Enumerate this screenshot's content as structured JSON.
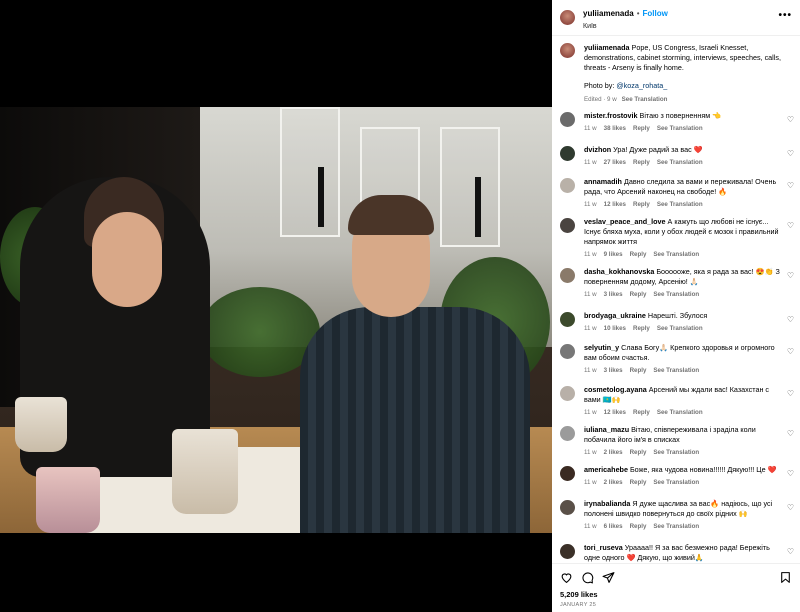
{
  "post": {
    "username": "yuliiamenada",
    "follow_label": "Follow",
    "location": "Київ",
    "more_label": "•••",
    "caption_text": " Pope, US Congress, Israeli Knesset, demonstrations, cabinet storming, interviews, speeches, calls, threats - Arseny is finally home.",
    "photo_by_label": "Photo by: ",
    "photo_by_handle": "@koza_rohata_",
    "edited": "Edited · 9 w",
    "see_translation": "See Translation",
    "likes": "5,209 likes",
    "date": "JANUARY 25"
  },
  "comments": [
    {
      "user": "mister.frostovik",
      "text": "Вітаю з поверненням 👈",
      "time": "11 w",
      "likes": "38 likes",
      "reply": "Reply",
      "translate": "See Translation",
      "avatar_color": "#6b6b6b"
    },
    {
      "user": "dvizhon",
      "text": "Ура! Дуже радий за вас ❤️",
      "time": "11 w",
      "likes": "27 likes",
      "reply": "Reply",
      "translate": "See Translation",
      "avatar_color": "#2f3a2f"
    },
    {
      "user": "annamadih",
      "text": "Давно следила за вами и переживала! Очень рада, что Арсений наконец на свободе! 🔥",
      "time": "11 w",
      "likes": "12 likes",
      "reply": "Reply",
      "translate": "See Translation",
      "avatar_color": "#b9b1a8"
    },
    {
      "user": "veslav_peace_and_love",
      "text": "А кажуть що любові не існує... Існує бляха муха, коли у обох людей є мозок і правильний напрямок життя",
      "time": "11 w",
      "likes": "9 likes",
      "reply": "Reply",
      "translate": "See Translation",
      "avatar_color": "#4a4440"
    },
    {
      "user": "dasha_kokhanovska",
      "text": "Боооооже, яка я рада за вас! 😍👏 З поверненням додому, Арсенію! 🙏🏻",
      "time": "11 w",
      "likes": "3 likes",
      "reply": "Reply",
      "translate": "See Translation",
      "avatar_color": "#8a7a6a"
    },
    {
      "user": "brodyaga_ukraine",
      "text": "Нарешті. Збулося",
      "time": "11 w",
      "likes": "10 likes",
      "reply": "Reply",
      "translate": "See Translation",
      "avatar_color": "#3c4a2c"
    },
    {
      "user": "selyutin_y",
      "text": "Слава Богу🙏🏻 Крепкого здоровья и огромного вам обоим счастья.",
      "time": "11 w",
      "likes": "3 likes",
      "reply": "Reply",
      "translate": "See Translation",
      "avatar_color": "#777777"
    },
    {
      "user": "cosmetolog.ayana",
      "text": "Арсений мы ждали вас! Казахстан с вами 🇰🇿🙌",
      "time": "11 w",
      "likes": "12 likes",
      "reply": "Reply",
      "translate": "See Translation",
      "avatar_color": "#b8b0a8"
    },
    {
      "user": "iuliana_mazu",
      "text": "Вітаю, співпереживала і зраділа коли побачила його ім'я в списках",
      "time": "11 w",
      "likes": "2 likes",
      "reply": "Reply",
      "translate": "See Translation",
      "avatar_color": "#9b9b9b"
    },
    {
      "user": "americahebe",
      "text": "Боже, яка чудова новина!!!!!! Дякую!!! Це ❤️",
      "time": "11 w",
      "likes": "2 likes",
      "reply": "Reply",
      "translate": "See Translation",
      "avatar_color": "#3a2a22"
    },
    {
      "user": "irynabalianda",
      "text": "Я дуже щаслива за вас🔥 надіюсь, що усі полонені швидко повернуться до своїх рідних 🙌",
      "time": "11 w",
      "likes": "6 likes",
      "reply": "Reply",
      "translate": "See Translation",
      "avatar_color": "#5a5048"
    },
    {
      "user": "tori_ruseva",
      "text": "Ураааа!! Я за вас безмежно рада! Бережіть одне одного ❤️ Дякую, що живий🙏",
      "time": "",
      "likes": "",
      "reply": "",
      "translate": "",
      "avatar_color": "#3b3028"
    }
  ]
}
